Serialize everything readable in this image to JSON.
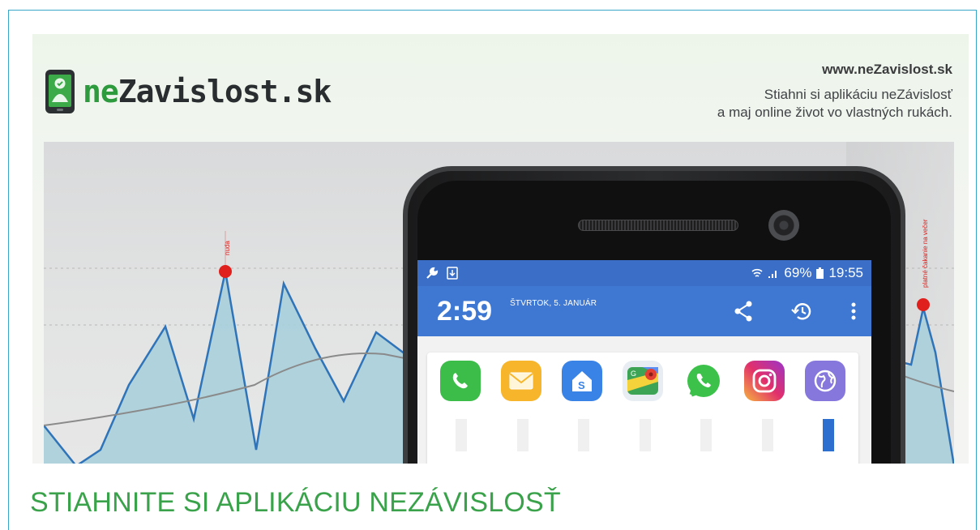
{
  "banner": {
    "logo_text_prefix": "ne",
    "logo_text_rest": "Zavislost.sk",
    "url": "www.neZavislost.sk",
    "tagline_line1": "Stiahni si aplikáciu neZávislosť",
    "tagline_line2": "a maj online život vo vlastných rukách."
  },
  "chart": {
    "left_marker_label": "nuda",
    "right_marker_label": "platné čakanie na večer",
    "marker_color": "#e0201c",
    "line_color": "#2f73b8",
    "fill_color": "#a7cfdc"
  },
  "phone": {
    "status_bar": {
      "left_icons": [
        "wrench-icon",
        "download-icon"
      ],
      "battery": "69%",
      "clock": "19:55"
    },
    "app_bar": {
      "time": "2:59",
      "date": "ŠTVRTOK, 5. JANUÁR"
    },
    "actions": [
      "share-icon",
      "history-icon",
      "more-icon"
    ],
    "apps": [
      {
        "name": "phone-app-icon",
        "color": "#39b54a"
      },
      {
        "name": "email-app-icon",
        "color": "#f6b52b"
      },
      {
        "name": "store-app-icon",
        "color": "#3a83e6"
      },
      {
        "name": "maps-app-icon",
        "color": "#e9eef3"
      },
      {
        "name": "whatsapp-app-icon",
        "color": "#ffffff"
      },
      {
        "name": "instagram-app-icon",
        "color": "#d13a8c"
      },
      {
        "name": "browser-app-icon",
        "color": "#8a7de0"
      }
    ]
  },
  "page": {
    "heading": "STIAHNITE SI APLIKÁCIU NEZÁVISLOSŤ",
    "accent": "#3aa24a",
    "border": "#3aa6c8"
  }
}
